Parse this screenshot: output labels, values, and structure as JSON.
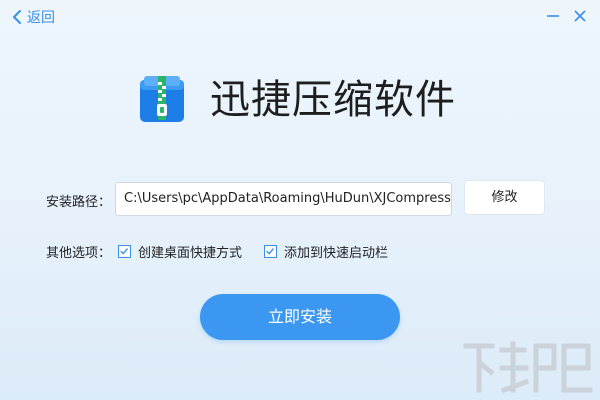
{
  "topbar": {
    "back_label": "返回"
  },
  "brand": {
    "title": "迅捷压缩软件",
    "logo_icon": "zip-archive-icon"
  },
  "install_path": {
    "label": "安装路径：",
    "value": "C:\\Users\\pc\\AppData\\Roaming\\HuDun\\XJCompress",
    "modify_label": "修改"
  },
  "options": {
    "label": "其他选项：",
    "items": [
      {
        "label": "创建桌面快捷方式",
        "checked": true
      },
      {
        "label": "添加到快速启动栏",
        "checked": true
      }
    ]
  },
  "install_button": {
    "label": "立即安装"
  },
  "colors": {
    "accent": "#3b97f0",
    "link": "#3a8fe6",
    "background": "#e8f2fb"
  }
}
